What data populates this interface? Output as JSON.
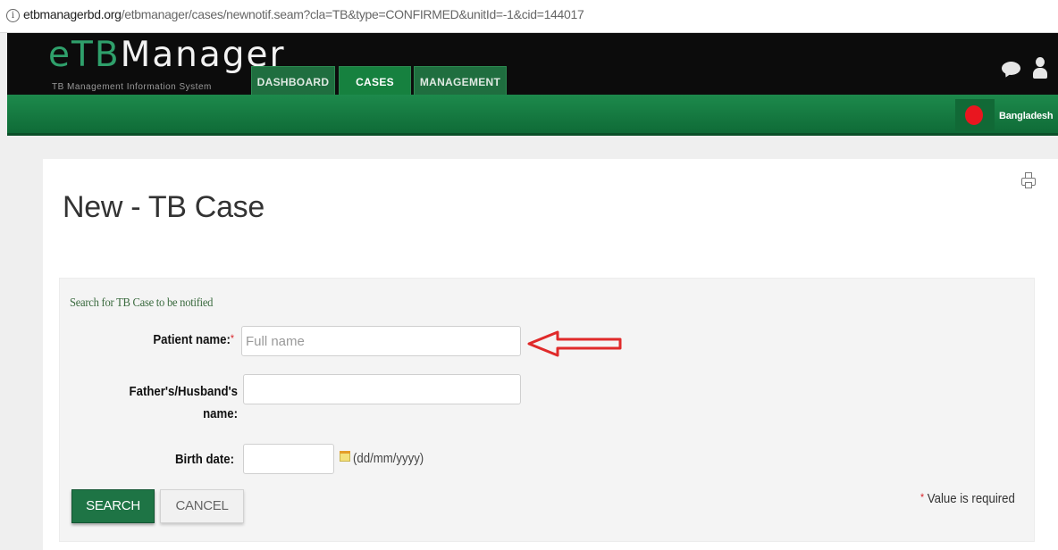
{
  "browser": {
    "url_host": "etbmanagerbd.org",
    "url_path": "/etbmanager/cases/newnotif.seam?cla=TB&type=CONFIRMED&unitId=-1&cid=144017",
    "info_icon": "i"
  },
  "header": {
    "logo_e": "e",
    "logo_tb": "TB",
    "logo_rest": "Manager",
    "logo_subtitle": "TB Management Information System",
    "tabs": [
      {
        "label": "DASHBOARD",
        "active": false
      },
      {
        "label": "CASES",
        "active": true
      },
      {
        "label": "MANAGEMENT",
        "active": false
      }
    ],
    "country": "Bangladesh",
    "icons": [
      "chat-icon",
      "user-icon",
      "flag-icon"
    ]
  },
  "main": {
    "page_title": "New - TB Case",
    "print_icon": "printer-icon",
    "section_title": "Search for TB Case to be notified",
    "fields": {
      "patient_name": {
        "label": "Patient name:",
        "required_mark": "*",
        "placeholder": "Full name",
        "value": ""
      },
      "father_husband_name": {
        "label_line1": "Father's/Husband's",
        "label_line2": "name:",
        "value": ""
      },
      "birth_date": {
        "label": "Birth date:",
        "value": "",
        "format_hint": "(dd/mm/yyyy)"
      }
    },
    "buttons": {
      "search_label": "SEARCH",
      "cancel_label": "CANCEL"
    },
    "required_note_star": "*",
    "required_note": " Value is required"
  },
  "colors": {
    "header_black": "#0c0c0c",
    "brand_green": "#1d8a4c",
    "tab_green": "#1f6e3f",
    "button_green": "#1e7445",
    "required_red": "#d9262b",
    "annotation_arrow": "#e02a2a"
  }
}
